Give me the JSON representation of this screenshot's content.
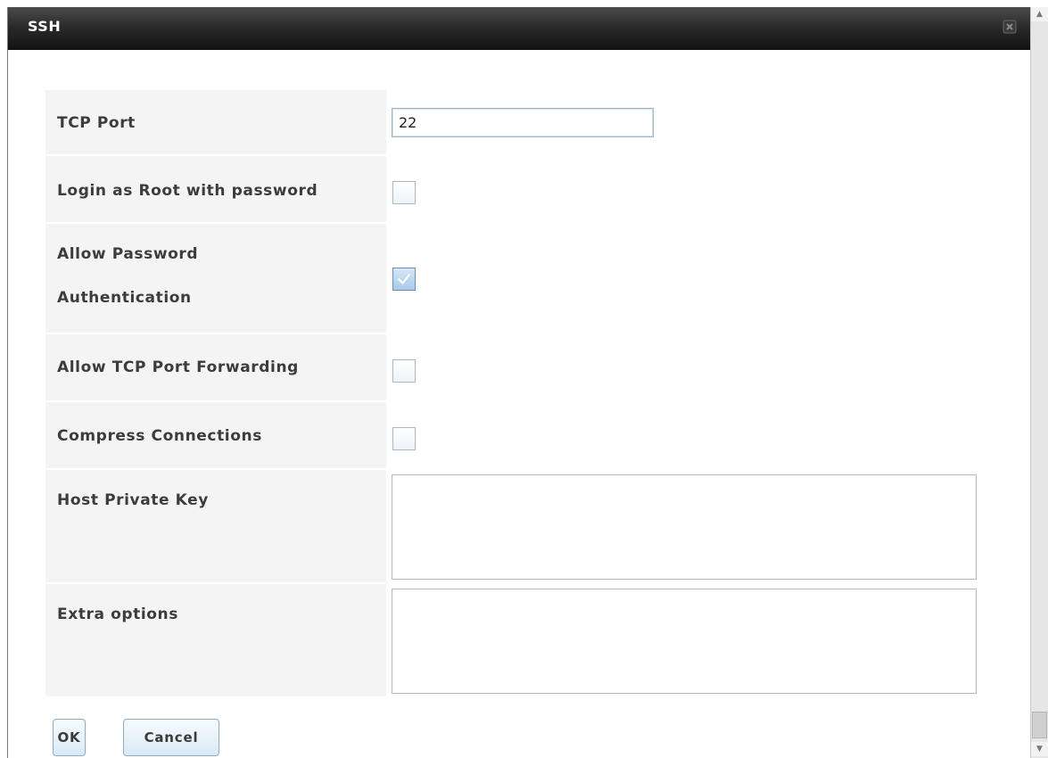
{
  "dialog": {
    "title": "SSH",
    "close_icon": "close-icon"
  },
  "form": {
    "tcp_port": {
      "label": "TCP Port",
      "value": "22"
    },
    "login_root": {
      "label": "Login as Root with password",
      "checked": false
    },
    "allow_password_auth": {
      "label_line1": "Allow Password",
      "label_line2": "Authentication",
      "checked": true
    },
    "allow_tcp_forwarding": {
      "label": "Allow TCP Port Forwarding",
      "checked": false
    },
    "compress_connections": {
      "label": "Compress Connections",
      "checked": false
    },
    "host_private_key": {
      "label": "Host Private Key",
      "value": ""
    },
    "extra_options": {
      "label": "Extra options",
      "value": ""
    }
  },
  "buttons": {
    "ok": "OK",
    "cancel": "Cancel"
  },
  "scrollbar": {
    "up_arrow": "▲",
    "down_arrow": "▼"
  }
}
